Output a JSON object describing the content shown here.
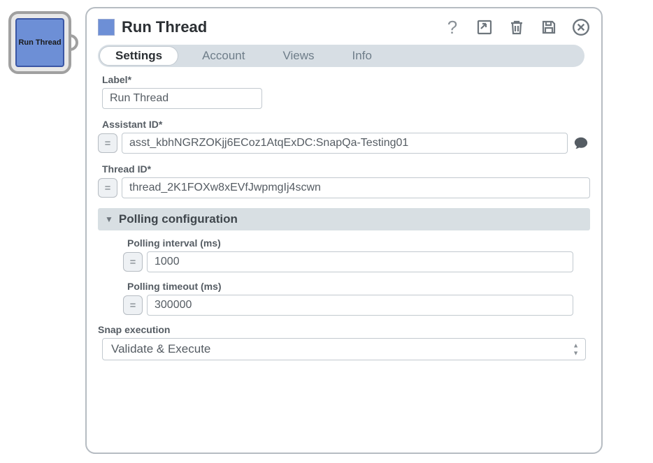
{
  "node": {
    "label": "Run Thread"
  },
  "header": {
    "title": "Run Thread"
  },
  "tabs": [
    {
      "label": "Settings",
      "active": true
    },
    {
      "label": "Account"
    },
    {
      "label": "Views"
    },
    {
      "label": "Info"
    }
  ],
  "form": {
    "label_field": {
      "label": "Label*",
      "value": "Run Thread"
    },
    "assistant_id": {
      "label": "Assistant ID*",
      "value": "asst_kbhNGRZOKjj6ECoz1AtqExDC:SnapQa-Testing01"
    },
    "thread_id": {
      "label": "Thread ID*",
      "value": "thread_2K1FOXw8xEVfJwpmgIj4scwn"
    },
    "polling": {
      "title": "Polling configuration",
      "interval": {
        "label": "Polling interval (ms)",
        "value": "1000"
      },
      "timeout": {
        "label": "Polling timeout (ms)",
        "value": "300000"
      }
    },
    "snap_execution": {
      "label": "Snap execution",
      "value": "Validate & Execute"
    }
  },
  "glyphs": {
    "equals": "="
  }
}
